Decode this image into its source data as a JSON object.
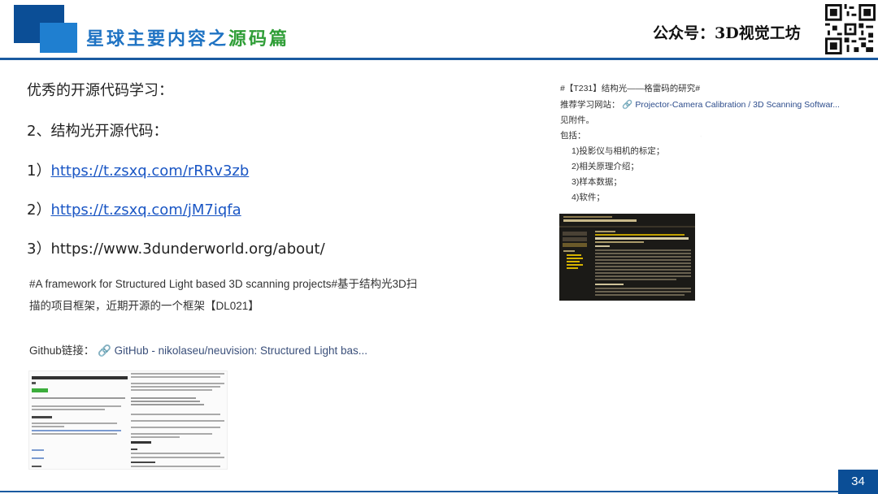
{
  "header": {
    "title_main": "星球主要内容之",
    "title_highlight": "源码篇",
    "account": "公众号：3D视觉工坊"
  },
  "left": {
    "heading": "优秀的开源代码学习：",
    "section": "2、结构光开源代码：",
    "links": [
      {
        "num": "1）",
        "url": "https://t.zsxq.com/rRRv3zb"
      },
      {
        "num": "2）",
        "url": "https://t.zsxq.com/jM7iqfa"
      },
      {
        "num": "3）",
        "url": "https://www.3dunderworld.org/about/"
      }
    ],
    "snippet_line1": "#A framework for Structured Light based 3D scanning projects#基于结构光3D扫",
    "snippet_line2": "描的项目框架，近期开源的一个框架【DL021】",
    "github_label": "Github链接：",
    "github_link": "GitHub - nikolaseu/neuvision: Structured Light bas..."
  },
  "right": {
    "topic": "#【T231】结构光——格雷码的研究#",
    "site_label": "推荐学习网站：",
    "site_link": "Projector-Camera Calibration / 3D Scanning Softwar...",
    "attach": "见附件。",
    "include": "包括：",
    "items": [
      "1)投影仪与相机的标定；",
      "2)相关原理介绍；",
      "3)样本数据；",
      "4)软件；"
    ]
  },
  "page_number": "34",
  "colors": {
    "brand_blue": "#1f73c3",
    "dark_blue": "#0b4e96",
    "highlight_green": "#2f9e37",
    "link_blue": "#1a56c4"
  }
}
